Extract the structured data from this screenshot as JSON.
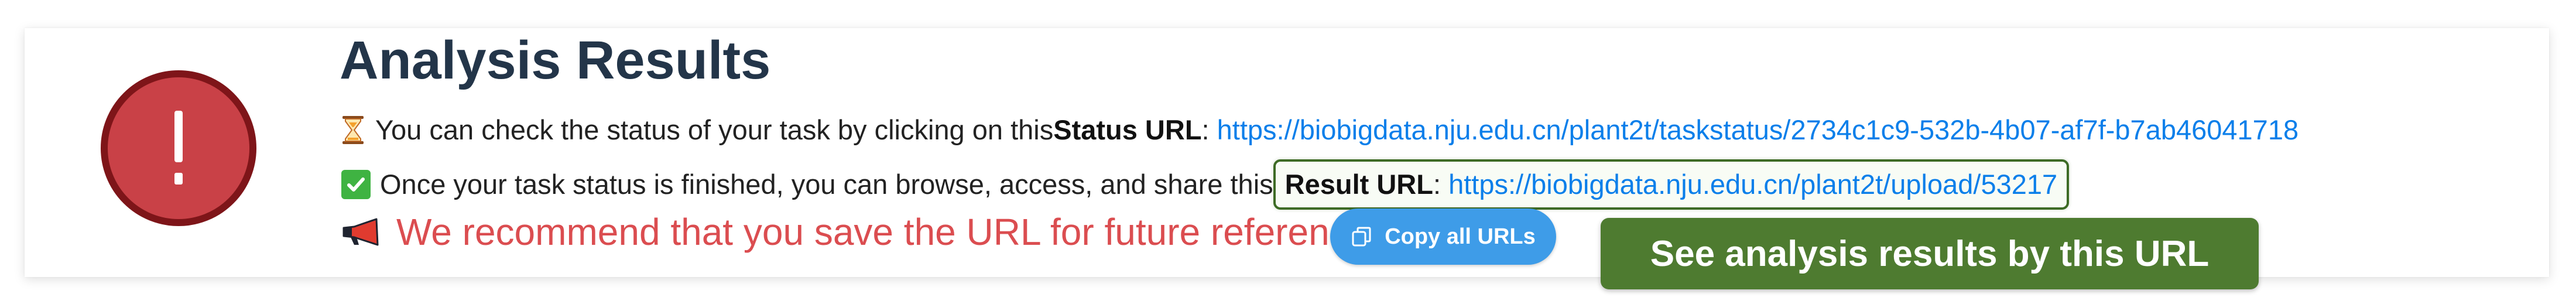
{
  "title": "Analysis Results",
  "status_line": {
    "text": "You can check the status of your task by clicking on this ",
    "label": "Status URL",
    "separator": ":",
    "url": "https://biobigdata.nju.edu.cn/plant2t/taskstatus/2734c1c9-532b-4b07-af7f-b7ab46041718"
  },
  "result_line": {
    "text": "Once your task status is finished, you can browse, access, and share this ",
    "label": "Result URL",
    "separator": ":",
    "url": "https://biobigdata.nju.edu.cn/plant2t/upload/53217"
  },
  "recommendation": "We recommend that you save the URL for future reference.",
  "copy_button_label": "Copy all URLs",
  "see_results_button_label": "See analysis results by this URL",
  "icons": {
    "alert": "exclamation-circle-icon",
    "status": "hourglass-icon",
    "result": "check-box-icon",
    "recommend": "megaphone-icon",
    "copy": "copy-icon"
  },
  "colors": {
    "alert_fill": "#c94147",
    "alert_border": "#7e1519",
    "title": "#233549",
    "link": "#0b7fea",
    "recommendation": "#db4d50",
    "copy_button": "#3e9ce8",
    "see_results_button": "#4e7b30",
    "result_box_border": "#3d6b25"
  }
}
